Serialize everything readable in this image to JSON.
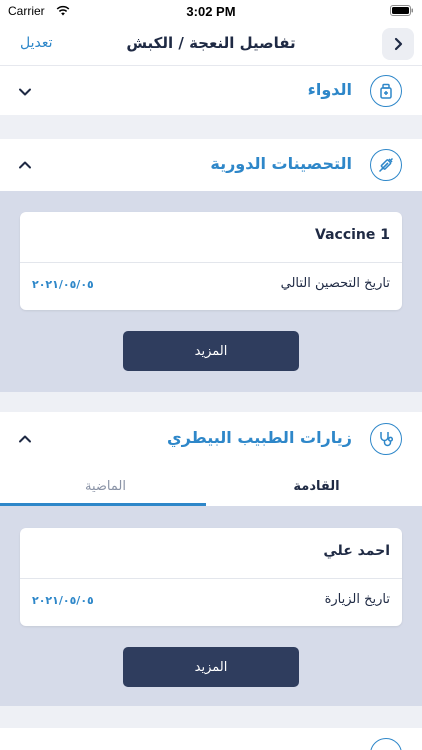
{
  "status_bar": {
    "carrier": "Carrier",
    "time": "3:02 PM"
  },
  "nav": {
    "edit_label": "تعديل",
    "title": "تفاصيل النعجة / الكبش"
  },
  "sections": {
    "medicine": {
      "title": "الدواء",
      "icon": "medicine-box-icon",
      "expanded": false
    },
    "vaccinations": {
      "title": "التحصينات الدورية",
      "icon": "syringe-icon",
      "expanded": true,
      "card": {
        "name": "Vaccine 1",
        "label": "تاريخ التحصين التالي",
        "date": "٢٠٢١/٠٥/٠٥"
      },
      "more_label": "المزيد"
    },
    "vet_visits": {
      "title": "زيارات الطبيب البيطري",
      "icon": "stethoscope-icon",
      "expanded": true,
      "tabs": {
        "upcoming": "القادمة",
        "past": "الماضية",
        "active": "upcoming"
      },
      "card": {
        "name": "احمد علي",
        "label": "تاريخ الزيارة",
        "date": "٢٠٢١/٠٥/٠٥"
      },
      "more_label": "المزيد"
    }
  },
  "colors": {
    "accent": "#2e87c9",
    "button": "#2f3d5e",
    "panel": "#d6dbe9",
    "gap": "#eef0f5"
  }
}
